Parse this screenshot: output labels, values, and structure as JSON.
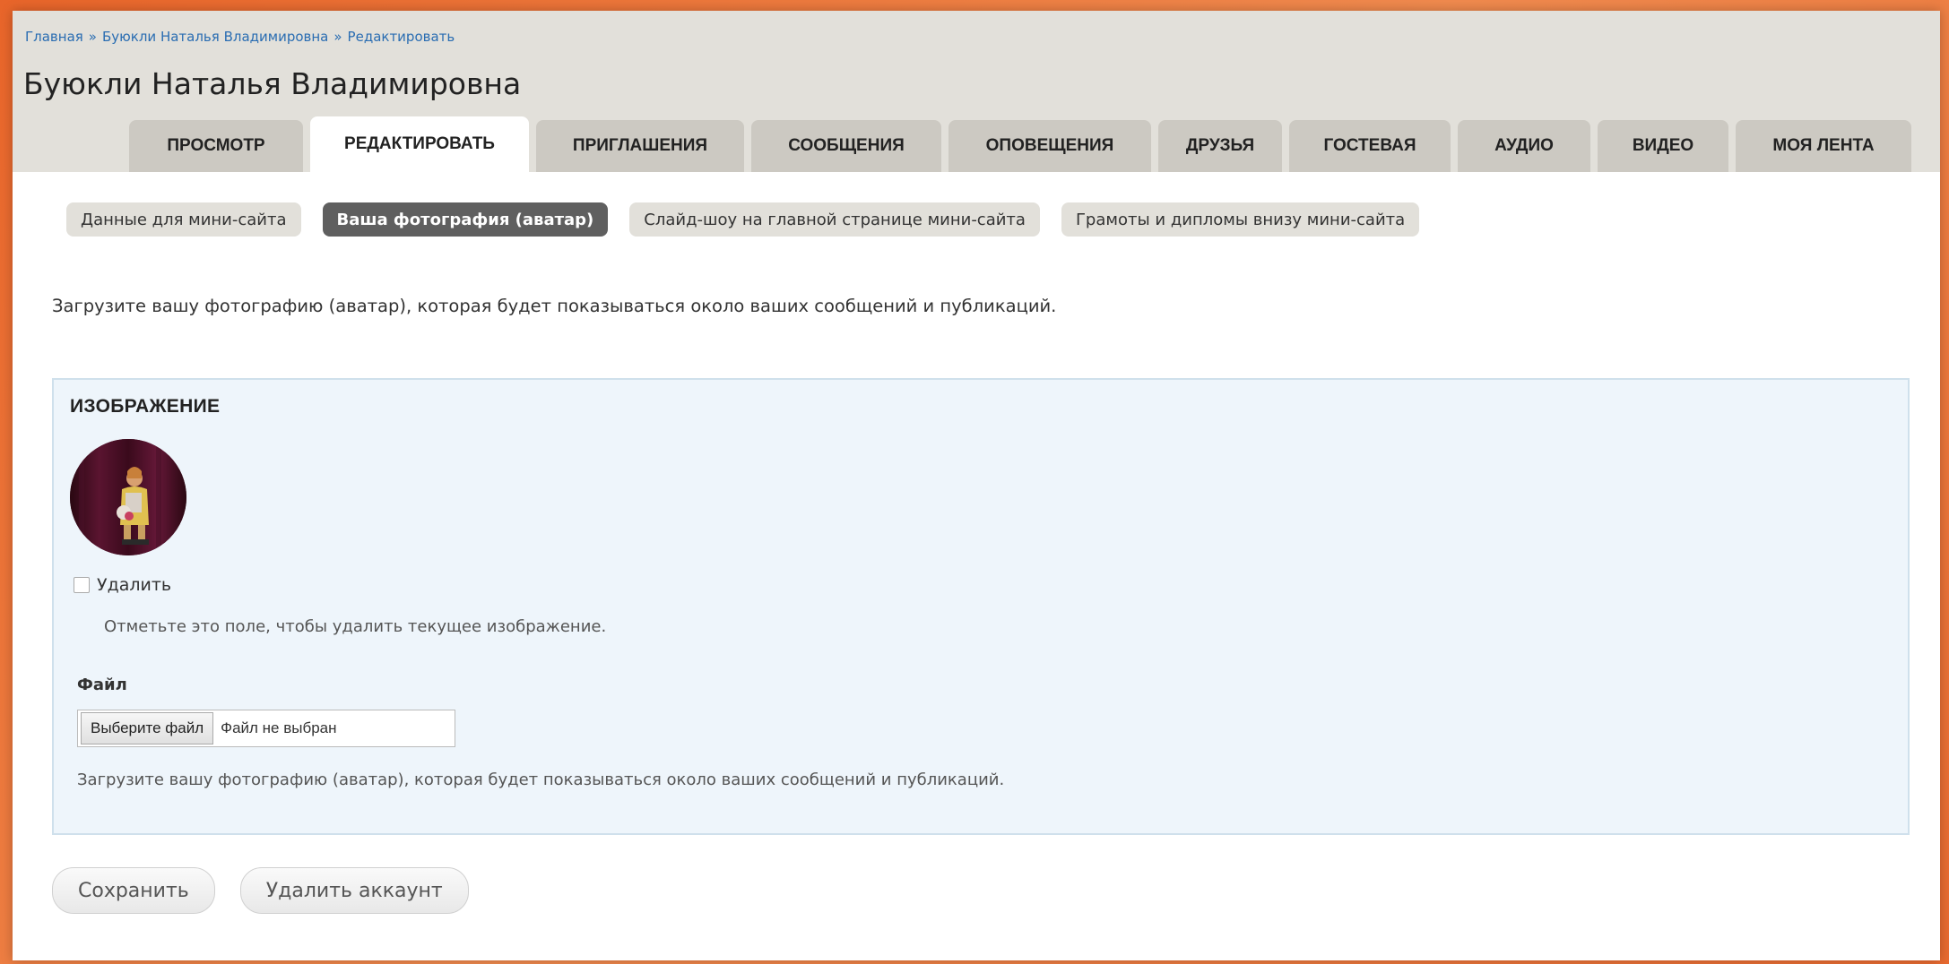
{
  "breadcrumb": {
    "items": [
      {
        "label": "Главная"
      },
      {
        "label": "Буюкли Наталья Владимировна"
      },
      {
        "label": "Редактировать"
      }
    ],
    "separator": "»"
  },
  "page_title": "Буюкли Наталья Владимировна",
  "tabs": [
    {
      "label": "ПРОСМОТР",
      "active": false
    },
    {
      "label": "РЕДАКТИРОВАТЬ",
      "active": true
    },
    {
      "label": "ПРИГЛАШЕНИЯ",
      "active": false
    },
    {
      "label": "СООБЩЕНИЯ",
      "active": false
    },
    {
      "label": "ОПОВЕЩЕНИЯ",
      "active": false
    },
    {
      "label": "ДРУЗЬЯ",
      "active": false
    },
    {
      "label": "ГОСТЕВАЯ",
      "active": false
    },
    {
      "label": "АУДИО",
      "active": false
    },
    {
      "label": "ВИДЕО",
      "active": false
    },
    {
      "label": "МОЯ ЛЕНТА",
      "active": false
    }
  ],
  "subtabs": [
    {
      "label": "Данные для мини-сайта",
      "active": false
    },
    {
      "label": "Ваша фотография (аватар)",
      "active": true
    },
    {
      "label": "Слайд-шоу на главной странице мини-сайта",
      "active": false
    },
    {
      "label": "Грамоты и дипломы внизу мини-сайта",
      "active": false
    }
  ],
  "intro_text": "Загрузите вашу фотографию (аватар), которая будет показываться около ваших сообщений и публикаций.",
  "image_panel": {
    "title": "ИЗОБРАЖЕНИЕ",
    "delete_checkbox": {
      "label": "Удалить",
      "checked": false
    },
    "delete_description": "Отметьте это поле, чтобы удалить текущее изображение.",
    "file_label": "Файл",
    "file_button": "Выберите файл",
    "file_status": "Файл не выбран",
    "file_description": "Загрузите вашу фотографию (аватар), которая будет показываться около ваших сообщений и публикаций."
  },
  "actions": {
    "save_label": "Сохранить",
    "delete_account_label": "Удалить аккаунт"
  },
  "colors": {
    "header_bg": "#e2e0da",
    "link": "#2a6db2",
    "active_subtab_bg": "#5f5f5f",
    "panel_bg": "#eef5fb",
    "outer_frame": "#e8652a"
  }
}
